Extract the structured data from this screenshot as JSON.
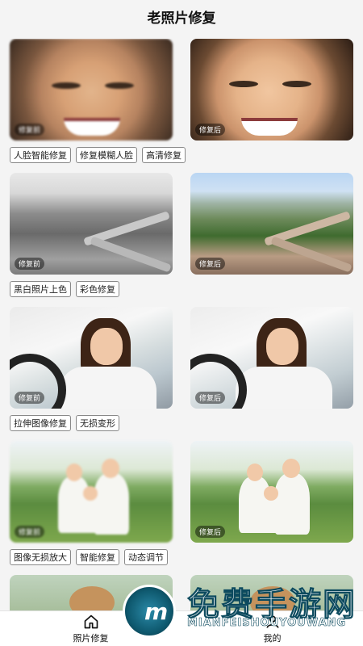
{
  "header": {
    "title": "老照片修复"
  },
  "badges": {
    "before": "修复前",
    "after": "修复后"
  },
  "cards": [
    {
      "tags": [
        "人脸智能修复",
        "修复模糊人脸",
        "高清修复"
      ]
    },
    {
      "tags": [
        "黑白照片上色",
        "彩色修复"
      ]
    },
    {
      "tags": [
        "拉伸图像修复",
        "无损变形"
      ]
    },
    {
      "tags": [
        "图像无损放大",
        "智能修复",
        "动态调节"
      ]
    }
  ],
  "tabbar": {
    "items": [
      {
        "label": "照片修复",
        "icon": "home-icon",
        "active": true
      },
      {
        "label": "我的",
        "icon": "user-icon",
        "active": false
      }
    ]
  },
  "watermark": {
    "title": "免费手游网",
    "subtitle": "MIANFEISHOUYOUWANG",
    "logo_letter": "m"
  }
}
